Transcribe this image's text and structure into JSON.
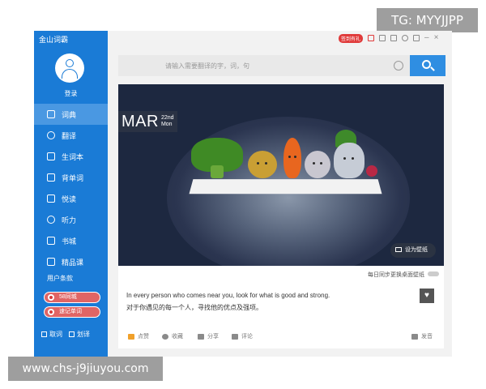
{
  "watermarks": {
    "tg": "TG: MYYJJPP",
    "url": "www.chs-j9jiuyou.com"
  },
  "app": {
    "brand": "金山词霸",
    "login": "登录"
  },
  "sidebar": {
    "items": [
      {
        "label": "词典",
        "icon": "book-icon",
        "active": true
      },
      {
        "label": "翻译",
        "icon": "translate-icon",
        "active": false
      },
      {
        "label": "生词本",
        "icon": "notebook-icon",
        "active": false
      },
      {
        "label": "背单词",
        "icon": "memorize-icon",
        "active": false
      },
      {
        "label": "悦读",
        "icon": "reading-icon",
        "active": false
      },
      {
        "label": "听力",
        "icon": "headphones-icon",
        "active": false
      },
      {
        "label": "书城",
        "icon": "bookstore-icon",
        "active": false
      },
      {
        "label": "精品课",
        "icon": "course-icon",
        "active": false
      }
    ],
    "terms": "用户条款",
    "promos": [
      "58同城",
      "速记单词"
    ],
    "options": [
      "取词",
      "划译"
    ]
  },
  "topbar": {
    "checkin": "签到有礼",
    "icons": [
      "gift-icon",
      "chat-icon",
      "skin-icon",
      "settings-icon",
      "window-icon",
      "minimize-icon",
      "close-icon"
    ]
  },
  "search": {
    "placeholder": "请输入需要翻译的字，词，句"
  },
  "card": {
    "month": "MAR",
    "day": "22nd",
    "weekday": "Mon",
    "wallpaper_label": "设为壁纸"
  },
  "sync": {
    "label": "每日同步更换桌面壁纸",
    "enabled": false
  },
  "quote": {
    "en": "In every person who comes near you, look for what is good and strong.",
    "zh": "对于你遇见的每一个人，寻找他的优点及强项。"
  },
  "actions": [
    "点赞",
    "收藏",
    "分享",
    "评论",
    "发音"
  ],
  "colors": {
    "sidebar": "#1a7bd6",
    "accent": "#2f8ee2",
    "checkin": "#e03a3a"
  }
}
